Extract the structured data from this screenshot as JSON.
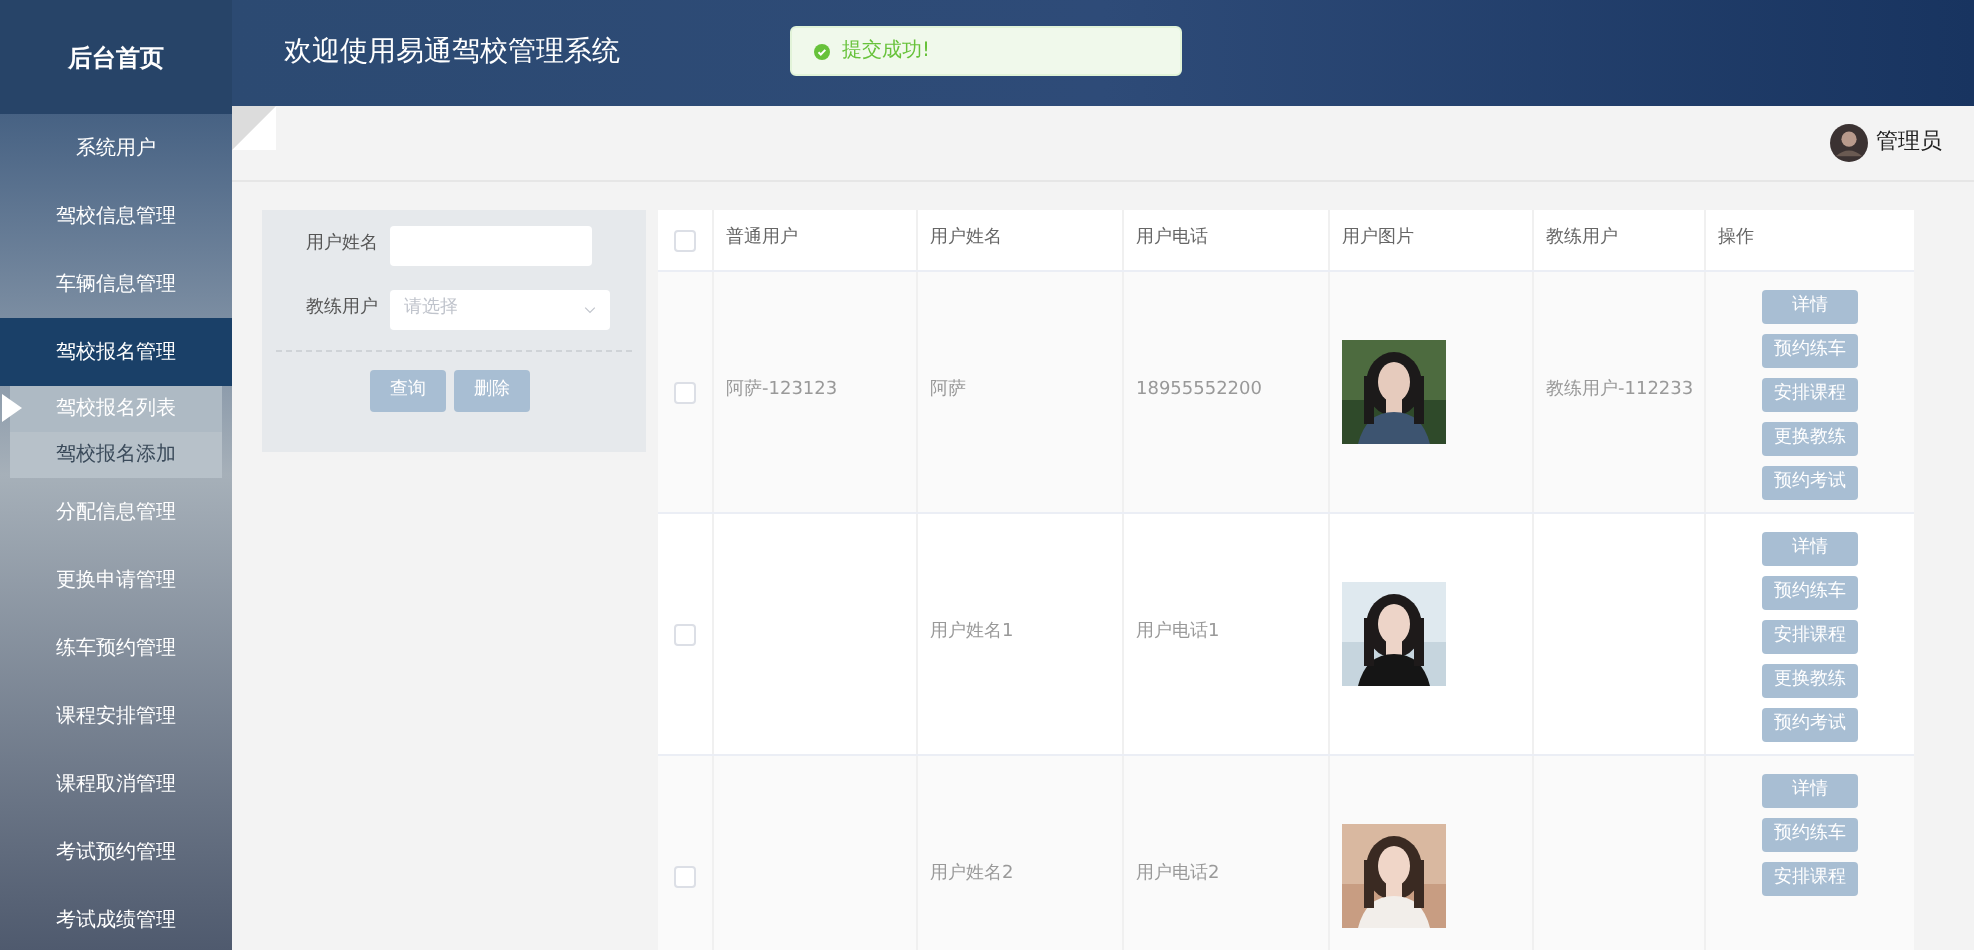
{
  "sidebar": {
    "title": "后台首页",
    "items": [
      {
        "label": "系统用户",
        "selected": false
      },
      {
        "label": "驾校信息管理",
        "selected": false
      },
      {
        "label": "车辆信息管理",
        "selected": false
      },
      {
        "label": "驾校报名管理",
        "selected": true,
        "expanded": true,
        "children": [
          {
            "label": "驾校报名列表",
            "selected": true
          },
          {
            "label": "驾校报名添加",
            "selected": false
          }
        ]
      },
      {
        "label": "分配信息管理",
        "selected": false
      },
      {
        "label": "更换申请管理",
        "selected": false
      },
      {
        "label": "练车预约管理",
        "selected": false
      },
      {
        "label": "课程安排管理",
        "selected": false
      },
      {
        "label": "课程取消管理",
        "selected": false
      },
      {
        "label": "考试预约管理",
        "selected": false
      },
      {
        "label": "考试成绩管理",
        "selected": false
      }
    ]
  },
  "header": {
    "title": "欢迎使用易通驾校管理系统"
  },
  "toast": {
    "kind": "success",
    "message": "提交成功!"
  },
  "user": {
    "name": "管理员"
  },
  "search": {
    "fields": [
      {
        "kind": "text",
        "label": "用户姓名"
      },
      {
        "kind": "select",
        "label": "教练用户",
        "placeholder": "请选择"
      }
    ],
    "buttons": [
      "查询",
      "删除"
    ]
  },
  "table": {
    "select_all": {
      "checked": false
    },
    "columns": [
      "普通用户",
      "用户姓名",
      "用户电话",
      "用户图片",
      "教练用户",
      "操作"
    ],
    "rows": [
      {
        "checked": false,
        "cells": [
          "阿萨-123123",
          "阿萨",
          "18955552200",
          {
            "kind": "picture"
          },
          "教练用户-112233"
        ],
        "actions": [
          "详情",
          "预约练车",
          "安排课程",
          "更换教练",
          "预约考试"
        ]
      },
      {
        "checked": false,
        "cells": [
          "",
          "用户姓名1",
          "用户电话1",
          {
            "kind": "picture"
          },
          ""
        ],
        "actions": [
          "详情",
          "预约练车",
          "安排课程",
          "更换教练",
          "预约考试"
        ]
      },
      {
        "checked": false,
        "cells": [
          "",
          "用户姓名2",
          "用户电话2",
          {
            "kind": "picture"
          },
          ""
        ],
        "actions": [
          "详情",
          "预约练车",
          "安排课程"
        ]
      }
    ]
  }
}
